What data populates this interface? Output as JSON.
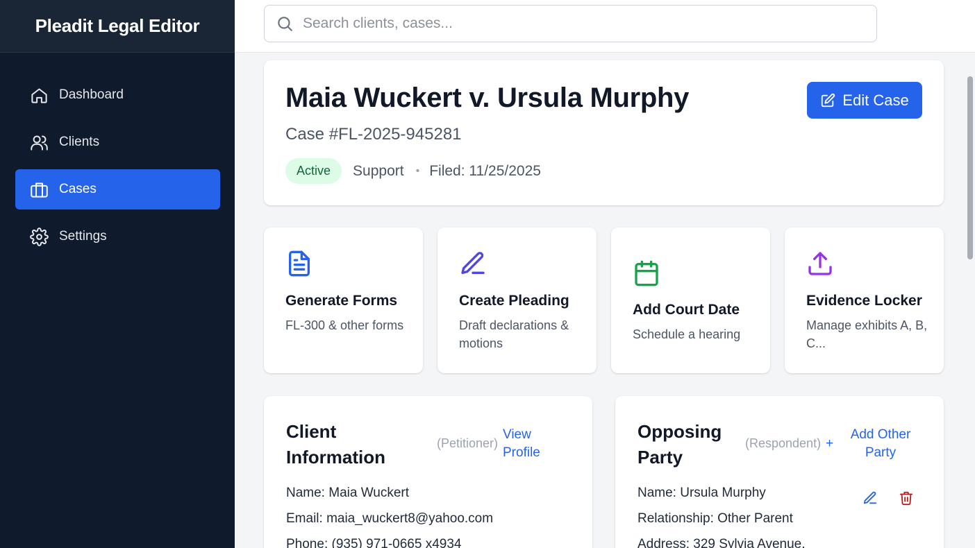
{
  "app": {
    "title": "Pleadit Legal Editor"
  },
  "sidebar": {
    "items": [
      {
        "label": "Dashboard",
        "icon": "home-icon"
      },
      {
        "label": "Clients",
        "icon": "users-icon"
      },
      {
        "label": "Cases",
        "icon": "briefcase-icon",
        "active": true
      },
      {
        "label": "Settings",
        "icon": "gear-icon"
      }
    ]
  },
  "search": {
    "placeholder": "Search clients, cases..."
  },
  "case": {
    "title": "Maia Wuckert v. Ursula Murphy",
    "number": "Case #FL-2025-945281",
    "status": "Active",
    "type": "Support",
    "separator": "•",
    "filed": "Filed: 11/25/2025",
    "edit_label": "Edit Case"
  },
  "actions": [
    {
      "title": "Generate Forms",
      "desc": "FL-300 & other forms",
      "icon": "document-icon",
      "color": "#2563eb"
    },
    {
      "title": "Create Pleading",
      "desc": "Draft declarations & motions",
      "icon": "pen-icon",
      "color": "#4f46e5"
    },
    {
      "title": "Add Court Date",
      "desc": "Schedule a hearing",
      "icon": "calendar-icon",
      "color": "#16a34a"
    },
    {
      "title": "Evidence Locker",
      "desc": "Manage exhibits A, B, C...",
      "icon": "upload-icon",
      "color": "#9333ea"
    }
  ],
  "client": {
    "title": "Client Information",
    "role": "(Petitioner)",
    "link": "View Profile",
    "name": "Name: Maia Wuckert",
    "email": "Email: maia_wuckert8@yahoo.com",
    "phone": "Phone: (935) 971-0665 x4934"
  },
  "opposing": {
    "title": "Opposing Party",
    "role": "(Respondent)",
    "link_plus": "+",
    "link": "Add Other Party",
    "name": "Name: Ursula Murphy",
    "relationship": "Relationship: Other Parent",
    "address": "Address: 329 Sylvia Avenue,"
  },
  "colors": {
    "accent": "#2563eb",
    "sidebar_bg": "#0f1a2c",
    "delete": "#b91c1c"
  }
}
